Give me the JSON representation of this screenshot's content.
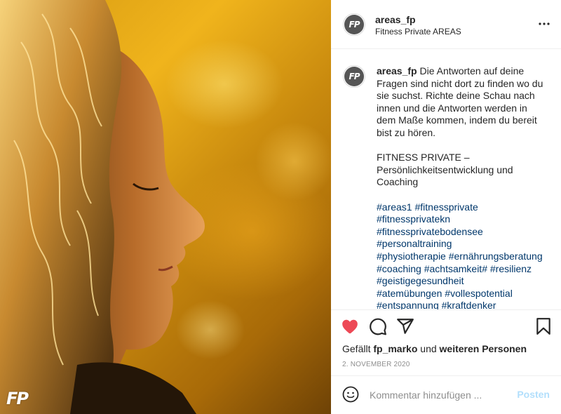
{
  "post": {
    "watermark": "FP",
    "avatar_initials": "FP",
    "username": "areas_fp",
    "subtitle": "Fitness Private AREAS",
    "caption": {
      "username": "areas_fp",
      "text": "Die Antworten auf deine Fragen sind nicht dort zu finden wo du sie suchst. Richte deine Schau nach innen und die Antworten werden in dem Maße kommen, indem du bereit bist zu hören.",
      "paragraph2": "FITNESS PRIVATE – Persönlichkeitsentwicklung und Coaching",
      "hashtag_lines": [
        "#areas1 #fitnessprivate",
        "#fitnessprivatekn",
        "#fitnessprivatebodensee",
        "#personaltraining",
        "#physiotherapie #ernährungsberatung",
        "#coaching #achtsamkeit# #resilienz",
        "#geistigegesundheit",
        "#atemübungen #vollespotential",
        "#entspannung #kraftdenker"
      ]
    },
    "likes": {
      "prefix": "Gefällt ",
      "user": "fp_marko",
      "middle": " und ",
      "rest": "weiteren Personen"
    },
    "date": "2. NOVEMBER 2020",
    "comment": {
      "placeholder": "Kommentar hinzufügen ...",
      "post_label": "Posten"
    }
  },
  "icons": [
    "more-icon",
    "heart-icon",
    "comment-icon",
    "share-icon",
    "bookmark-icon",
    "emoji-icon"
  ],
  "colors": {
    "like_red": "#ed4956",
    "hashtag_blue": "#00376b",
    "post_button_disabled": "#b2dffc",
    "muted_text": "#8e8e8e"
  }
}
